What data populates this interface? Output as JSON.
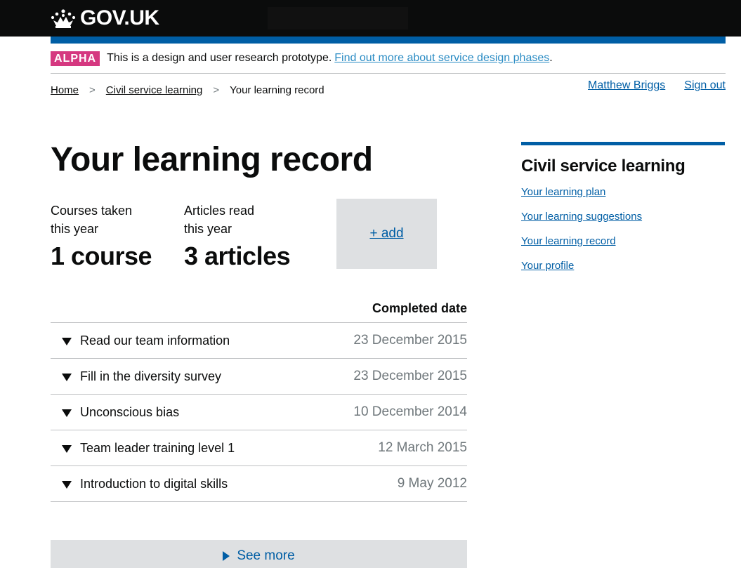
{
  "header": {
    "logo_text": "GOV.UK"
  },
  "phase_banner": {
    "tag": "ALPHA",
    "text": "This is a design and user research prototype.",
    "link": "Find out more about service design phases",
    "link_suffix": "."
  },
  "breadcrumbs": {
    "items": [
      "Home",
      "Civil service learning"
    ],
    "separator": ">",
    "current": "Your learning record"
  },
  "user_nav": {
    "name": "Matthew Briggs",
    "sign_out": "Sign out"
  },
  "page_title": "Your learning record",
  "stats": {
    "courses": {
      "label_line1": "Courses taken",
      "label_line2": "this year",
      "value": "1 course"
    },
    "articles": {
      "label_line1": "Articles read",
      "label_line2": "this year",
      "value": "3 articles"
    },
    "add_label": "+ add"
  },
  "records": {
    "date_header": "Completed date",
    "rows": [
      {
        "title": "Read our team information",
        "date": "23 December 2015"
      },
      {
        "title": "Fill in the diversity survey",
        "date": "23 December 2015"
      },
      {
        "title": "Unconscious bias",
        "date": "10 December 2014"
      },
      {
        "title": "Team leader training level 1",
        "date": "12 March 2015"
      },
      {
        "title": "Introduction to digital skills",
        "date": "9 May 2012"
      }
    ],
    "see_more": "See more"
  },
  "sidebar": {
    "title": "Civil service learning",
    "links": [
      "Your learning plan",
      "Your learning suggestions",
      "Your learning record",
      "Your profile"
    ]
  },
  "colors": {
    "header_bg": "#0b0c0c",
    "brand_blue": "#005ea5",
    "alpha_tag": "#d53880",
    "panel_grey": "#dee0e2",
    "secondary_text": "#6f777b"
  },
  "icons": {
    "logo": "crown-icon",
    "row_toggle": "triangle-down-icon",
    "see_more": "triangle-right-icon"
  }
}
